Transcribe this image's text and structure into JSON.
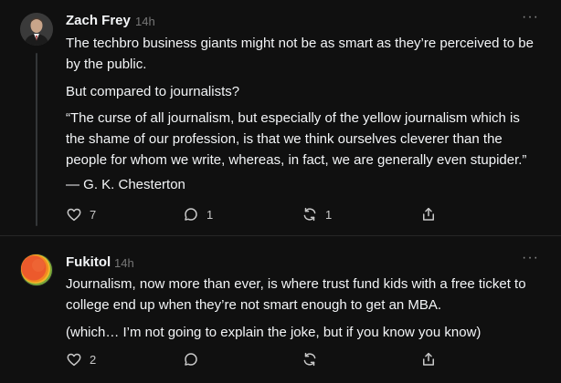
{
  "posts": [
    {
      "author": "Zach Frey",
      "time": "14h",
      "paragraphs": [
        "The techbro business giants might not be as smart as they’re perceived to be by the public.",
        "But compared to journalists?",
        "“The curse of all journalism, but especially of the yellow journalism which is the shame of our profession, is that we think ourselves cleverer than the people for whom we write, whereas, in fact, we are generally even stupider.”",
        "— G. K. Chesterton"
      ],
      "likes": "7",
      "replies": "1",
      "reposts": "1",
      "icons": [
        "heart-icon",
        "comment-icon",
        "repost-icon",
        "share-icon"
      ]
    },
    {
      "author": "Fukitol",
      "time": "14h",
      "paragraphs": [
        "Journalism, now more than ever, is where trust fund kids with a free ticket to college end up when they’re not smart enough to get an MBA.",
        "(which… I’m not going to explain the joke, but if you know you know)"
      ],
      "likes": "2",
      "replies": "",
      "reposts": "",
      "icons": [
        "heart-icon",
        "comment-icon",
        "repost-icon",
        "share-icon"
      ]
    }
  ],
  "colors": {
    "background": "#101010",
    "text": "#f3f5f7",
    "muted": "#777777",
    "divider": "#262626"
  }
}
